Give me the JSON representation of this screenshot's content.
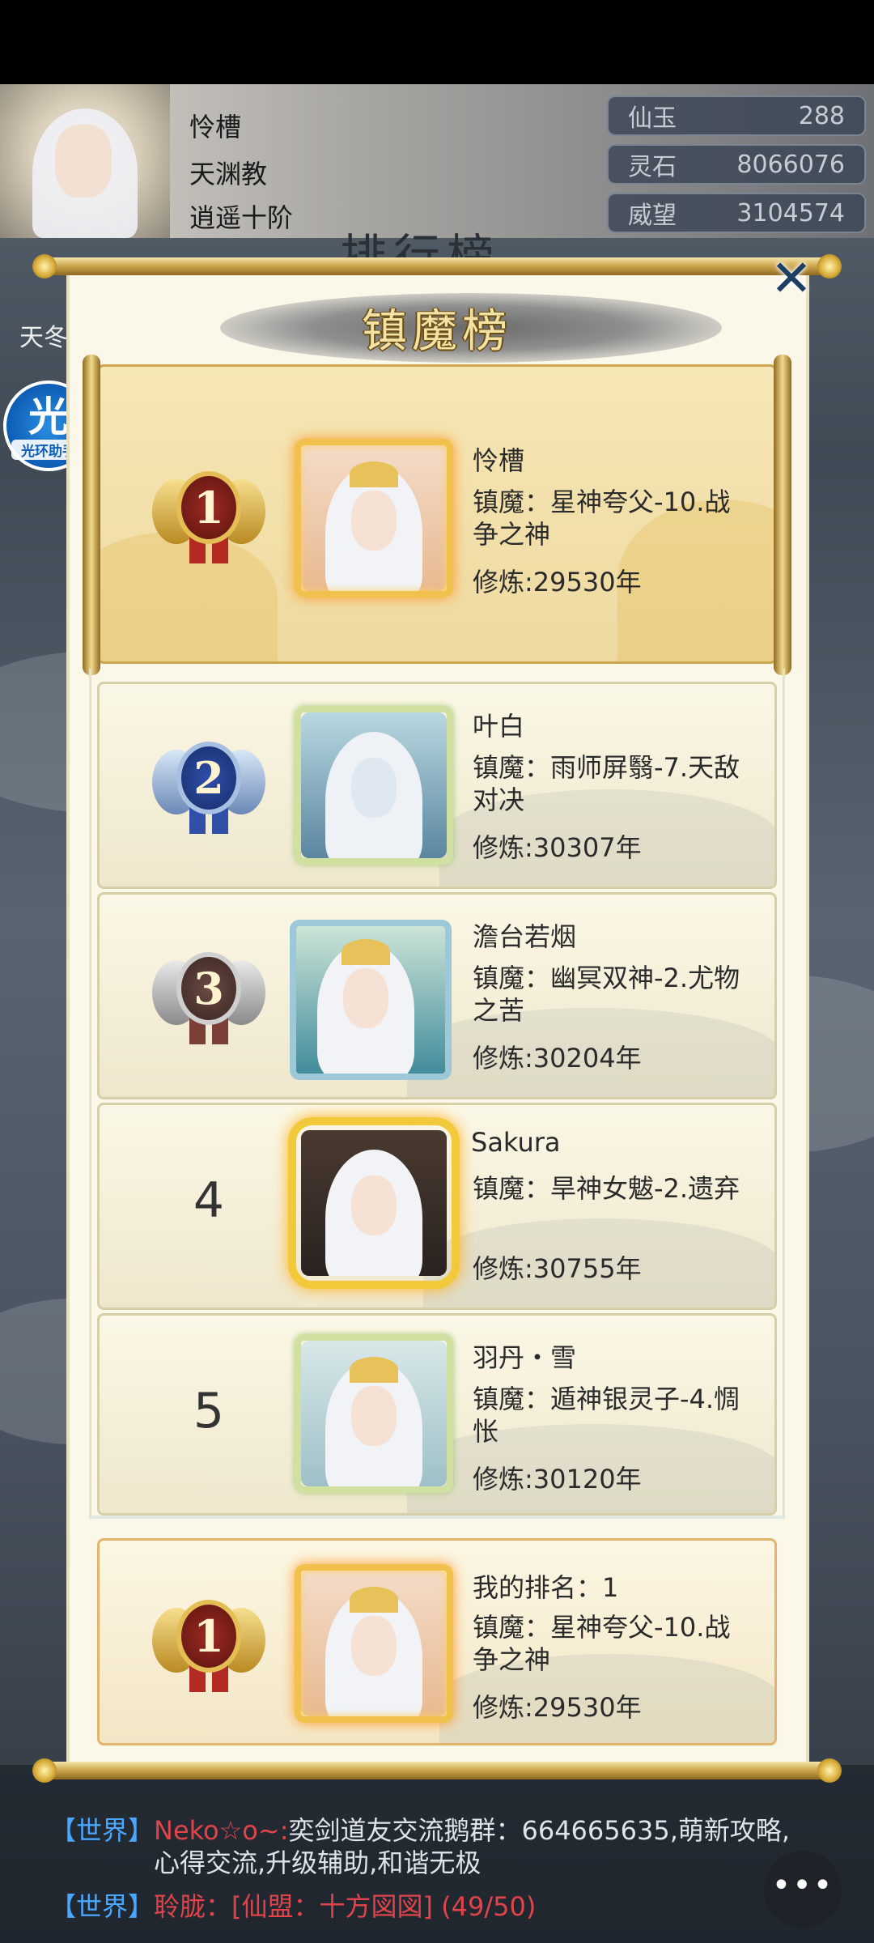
{
  "player": {
    "name": "怜槽",
    "sect": "天渊教",
    "realm": "逍遥十阶",
    "resources": [
      {
        "label": "仙玉",
        "value": "288"
      },
      {
        "label": "灵石",
        "value": "8066076"
      },
      {
        "label": "威望",
        "value": "3104574"
      }
    ]
  },
  "background_title": "排行榜",
  "side_left_label": "天冬",
  "helper": {
    "icon_text": "光",
    "label": "光环助手"
  },
  "modal": {
    "title": "镇魔榜",
    "close_symbol": "✕",
    "ranks": [
      {
        "rank": "1",
        "name": "怜槽",
        "stage": "镇魔：星神夸父-10.战争之神",
        "training": "修炼:29530年"
      },
      {
        "rank": "2",
        "name": "叶白",
        "stage": "镇魔：雨师屏翳-7.天敌对决",
        "training": "修炼:30307年"
      },
      {
        "rank": "3",
        "name": "澹台若烟",
        "stage": "镇魔：幽冥双神-2.尤物之苦",
        "training": "修炼:30204年"
      },
      {
        "rank": "4",
        "name": "Sakura",
        "stage": "镇魔：旱神女魃-2.遗弃",
        "training": "修炼:30755年"
      },
      {
        "rank": "5",
        "name": "羽丹・雪",
        "stage": "镇魔：遁神银灵子-4.惆怅",
        "training": "修炼:30120年"
      }
    ],
    "my_rank": {
      "rank": "1",
      "label": "我的排名：1",
      "stage": "镇魔：星神夸父-10.战争之神",
      "training": "修炼:29530年"
    }
  },
  "chat": {
    "lines": [
      {
        "channel": "【世界】",
        "name": "Neko☆o~:",
        "text": "奕剑道友交流鹅群：664665635,萌新攻略,"
      },
      {
        "channel": "",
        "name": "",
        "text": "心得交流,升级辅助,和谐无极"
      },
      {
        "channel": "【世界】",
        "name": "聆胧：",
        "text": "[仙盟：十方図図] (49/50)"
      }
    ],
    "button_symbol": "•••"
  },
  "colors": {
    "gold": "#e5bd55",
    "blue_medal": "#2f4fa8",
    "panel": "#fbf8ea",
    "chat_channel": "#4aa7ff",
    "chat_name": "#e0444a"
  }
}
